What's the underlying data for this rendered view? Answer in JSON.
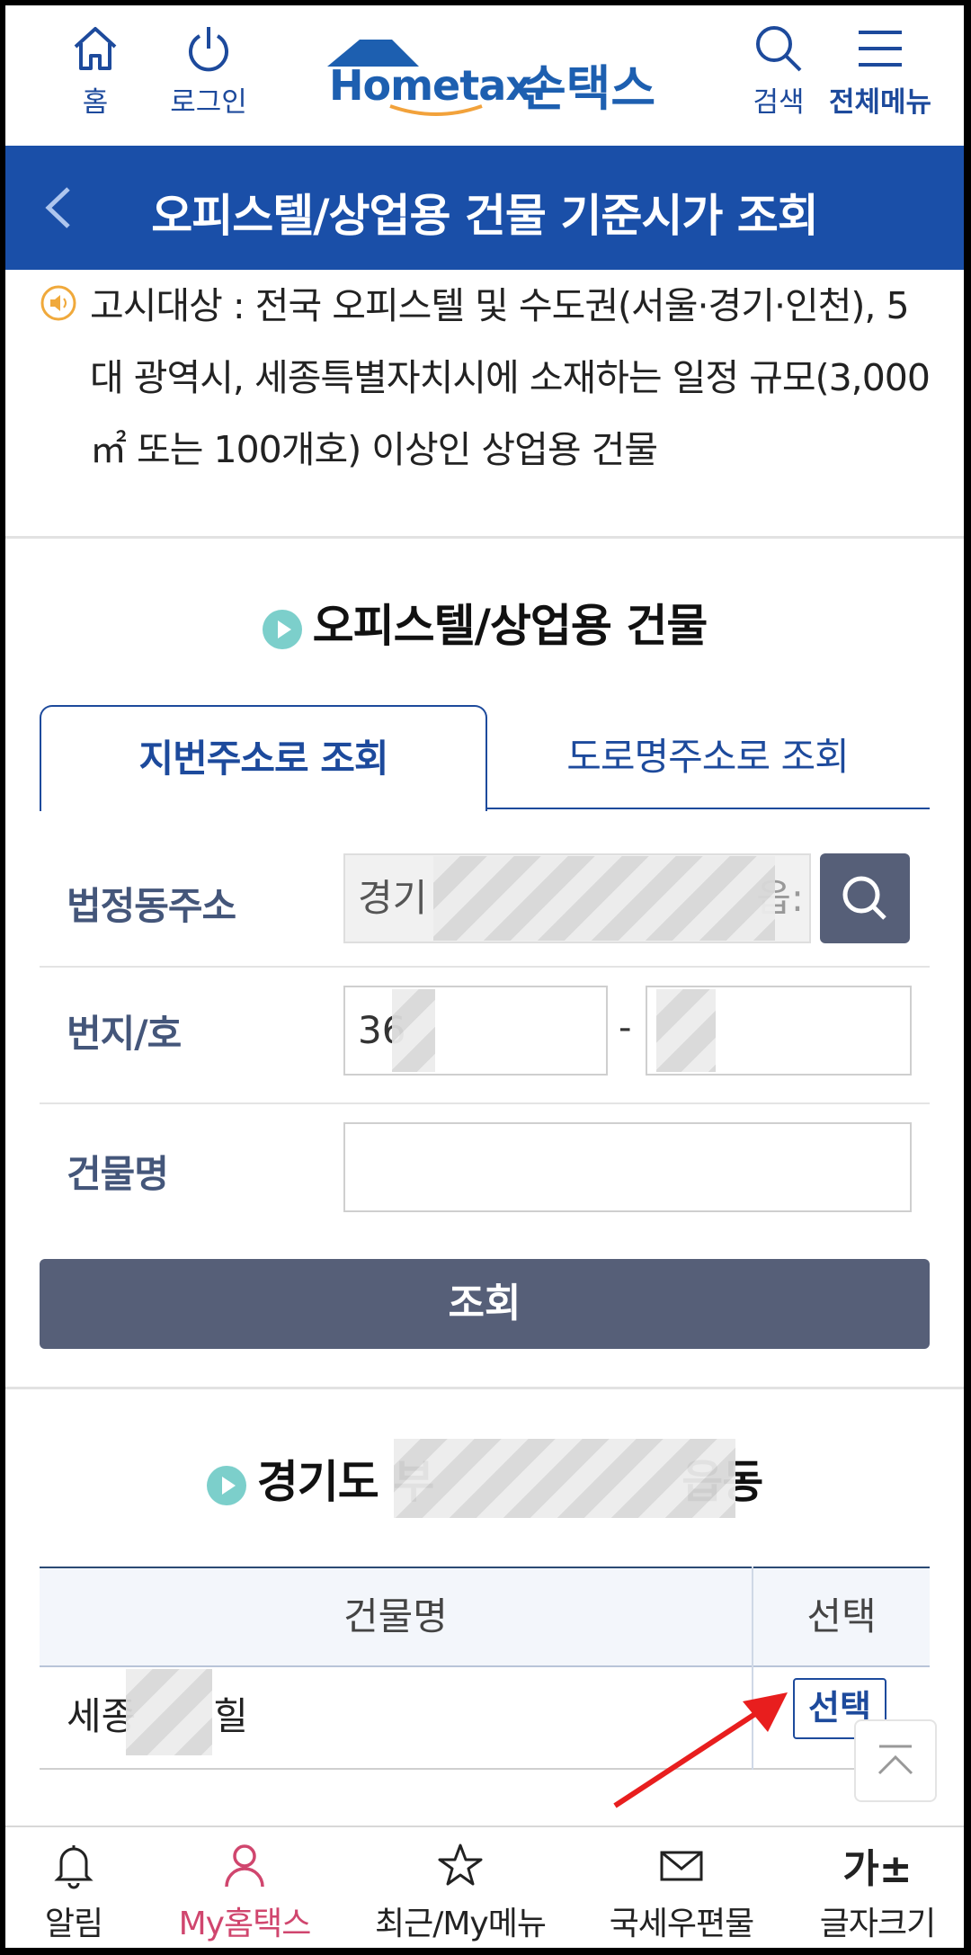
{
  "header": {
    "home_label": "홈",
    "login_label": "로그인",
    "logo_text": "Hometax.",
    "logo_son": "손택스",
    "search_label": "검색",
    "menu_label": "전체메뉴"
  },
  "titlebar": {
    "title": "오피스텔/상업용 건물 기준시가 조회"
  },
  "notice": {
    "text": "고시대상 : 전국 오피스텔 및 수도권(서울·경기·인천), 5대 광역시, 세종특별자치시에 소재하는 일정 규모(3,000㎡ 또는 100개호) 이상인 상업용 건물"
  },
  "section1": {
    "title": "오피스텔/상업용 건물"
  },
  "tabs": {
    "lot": "지번주소로 조회",
    "road": "도로명주소로 조회"
  },
  "form": {
    "addr_label": "법정동주소",
    "addr_value": "경기",
    "addr_tail": "읍:",
    "lot_label": "번지/호",
    "lot_main": "36",
    "lot_dash": "-",
    "lot_sub": "",
    "bldg_label": "건물명",
    "bldg_value": "",
    "query_button": "조회"
  },
  "section2": {
    "title_start": "경기도 부",
    "title_end": "읍동"
  },
  "table": {
    "col_name": "건물명",
    "col_select": "선택",
    "rows": [
      {
        "name_start": "세종",
        "name_end": "힐",
        "select": "선택"
      }
    ]
  },
  "bottom_nav": {
    "alert": "알림",
    "my": "My홈택스",
    "recent": "최근/My메뉴",
    "mail": "국세우편물",
    "fontsize": "글자크기",
    "fontsize_icon": "가±"
  },
  "colors": {
    "primary": "#1a4fa8",
    "accent_pink": "#d0466e",
    "button": "#565f78"
  }
}
